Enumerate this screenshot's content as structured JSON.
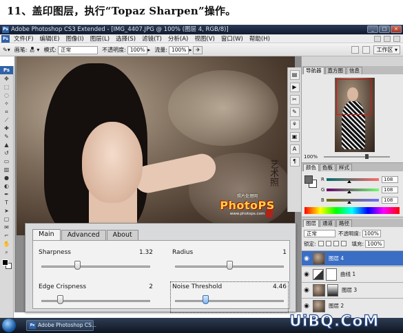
{
  "caption": "11、盖印图层，执行“Topaz Sharpen”操作。",
  "window": {
    "title": "Adobe Photoshop CS3 Extended - [IMG_4407.JPG @ 100% (图层 4, RGB/8)]",
    "app_icon": "Ps"
  },
  "menu": [
    "文件(F)",
    "编辑(E)",
    "图像(I)",
    "图层(L)",
    "选择(S)",
    "滤镜(T)",
    "分析(A)",
    "视图(V)",
    "窗口(W)",
    "帮助(H)"
  ],
  "options": {
    "brush_label": "画笔:",
    "brush_size": "60",
    "mode_label": "模式:",
    "mode_value": "正常",
    "opacity_label": "不透明度:",
    "opacity_value": "100%",
    "flow_label": "流量:",
    "flow_value": "100%",
    "workspace_label": "工作区"
  },
  "toolbox": {
    "header": "Ps",
    "tools": [
      "move-icon",
      "marquee-icon",
      "lasso-icon",
      "magic-wand-icon",
      "crop-icon",
      "slice-icon",
      "healing-icon",
      "brush-icon",
      "stamp-icon",
      "history-brush-icon",
      "eraser-icon",
      "gradient-icon",
      "blur-icon",
      "dodge-icon",
      "pen-icon",
      "type-icon",
      "path-select-icon",
      "shape-icon",
      "notes-icon",
      "eyedropper-icon",
      "hand-icon",
      "zoom-icon"
    ]
  },
  "canvas": {
    "watermark_top": "照片处理网",
    "watermark_main": "PhotoPS",
    "watermark_url": "www.photops.com"
  },
  "topaz": {
    "tabs": [
      "Main",
      "Advanced",
      "About"
    ],
    "active_tab": "Main",
    "sliders": [
      {
        "label": "Sharpness",
        "value": "1.32",
        "fraction": 0.33
      },
      {
        "label": "Radius",
        "value": "1",
        "fraction": 0.5
      },
      {
        "label": "Edge Crispness",
        "value": "2",
        "fraction": 0.17
      },
      {
        "label": "Noise Threshold",
        "value": "4.46",
        "fraction": 0.28
      }
    ]
  },
  "navigator": {
    "tabs": [
      "导航器",
      "直方图",
      "信息"
    ],
    "zoom": "100%"
  },
  "color_panel": {
    "tabs": [
      "颜色",
      "色板",
      "样式"
    ],
    "channels": [
      {
        "name": "R",
        "value": "108",
        "gradient": "linear-gradient(to right, #006c6c, #ff6c6c)"
      },
      {
        "name": "G",
        "value": "108",
        "gradient": "linear-gradient(to right, #6c006c, #6cff6c)"
      },
      {
        "name": "B",
        "value": "108",
        "gradient": "linear-gradient(to right, #6c6c00, #6c6cff)"
      }
    ]
  },
  "layers_panel": {
    "tabs": [
      "图层",
      "通道",
      "路径"
    ],
    "blend_mode": "正常",
    "opacity_label": "不透明度:",
    "opacity_value": "100%",
    "lock_label": "锁定:",
    "fill_label": "填充:",
    "fill_value": "100%",
    "layers": [
      {
        "name": "图层 4",
        "selected": true
      },
      {
        "name": "曲线 1",
        "selected": false
      },
      {
        "name": "图层 3",
        "selected": false
      },
      {
        "name": "图层 2",
        "selected": false
      }
    ]
  },
  "taskbar": {
    "task_label": "Adobe Photoshop CS..."
  },
  "brand": "UiBQ.CoM"
}
